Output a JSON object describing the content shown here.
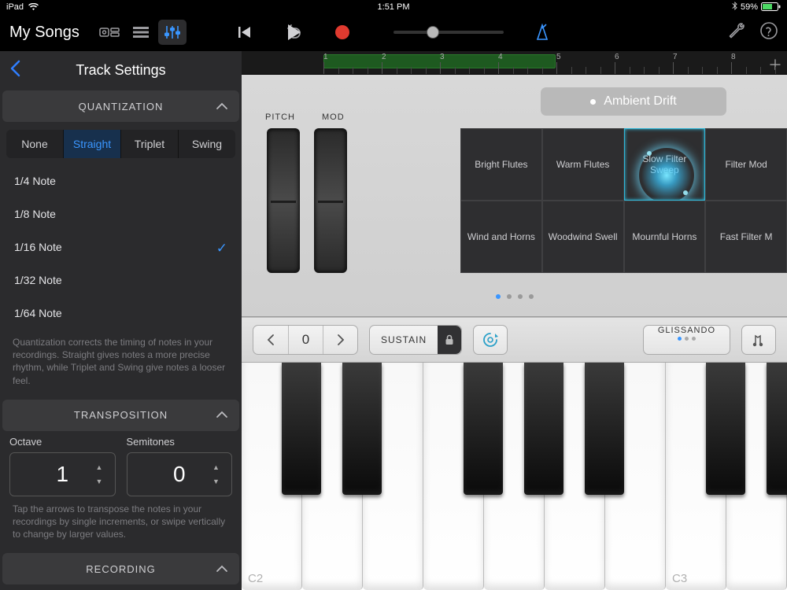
{
  "status": {
    "device": "iPad",
    "time": "1:51 PM",
    "battery": "59%"
  },
  "topbar": {
    "back": "My Songs"
  },
  "sidebar": {
    "title": "Track Settings",
    "sections": {
      "quantization": {
        "header": "QUANTIZATION",
        "segments": [
          "None",
          "Straight",
          "Triplet",
          "Swing"
        ],
        "active_segment": "Straight",
        "notes": [
          "1/4 Note",
          "1/8 Note",
          "1/16 Note",
          "1/32 Note",
          "1/64 Note"
        ],
        "selected_note": "1/16 Note",
        "help": "Quantization corrects the timing of notes in your recordings. Straight gives notes a more precise rhythm, while Triplet and Swing give notes a looser feel."
      },
      "transposition": {
        "header": "TRANSPOSITION",
        "octave_label": "Octave",
        "semitones_label": "Semitones",
        "octave_value": "1",
        "semitones_value": "0",
        "help": "Tap the arrows to transpose the notes in your recordings by single increments, or swipe vertically to change by larger values."
      },
      "recording": {
        "header": "RECORDING"
      }
    }
  },
  "instrument": {
    "ruler": {
      "bars": [
        "1",
        "2",
        "3",
        "4",
        "5",
        "6",
        "7",
        "8"
      ]
    },
    "preset": "Ambient Drift",
    "wheel_labels": {
      "pitch": "PITCH",
      "mod": "MOD"
    },
    "sound_grid": [
      "Bright Flutes",
      "Warm Flutes",
      "Slow Filter Sweep",
      "Filter Mod",
      "Wind and Horns",
      "Woodwind Swell",
      "Mournful Horns",
      "Fast Filter M"
    ],
    "playing_cell": 2,
    "controlstrip": {
      "octave_value": "0",
      "sustain": "SUSTAIN",
      "glissando": "GLISSANDO"
    },
    "key_labels": {
      "c2": "C2",
      "c3": "C3"
    }
  }
}
